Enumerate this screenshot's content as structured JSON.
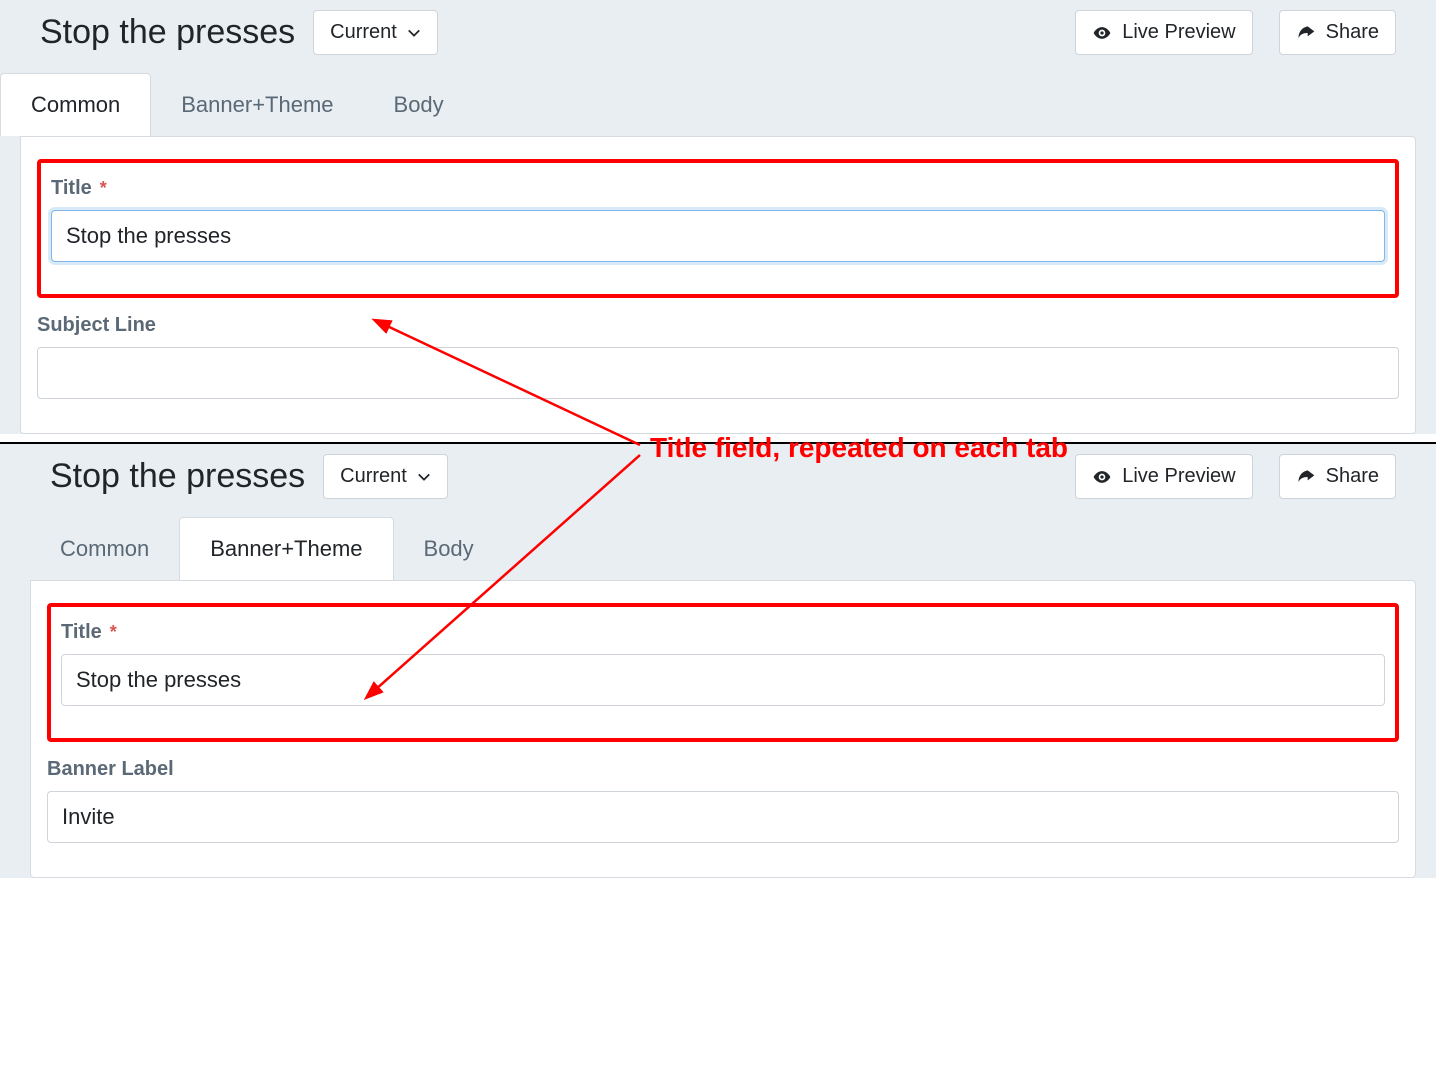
{
  "top": {
    "title": "Stop the presses",
    "dropdown": "Current",
    "preview": "Live Preview",
    "share": "Share",
    "tabs": [
      "Common",
      "Banner+Theme",
      "Body"
    ],
    "active_tab": 0,
    "fields": {
      "title_label": "Title",
      "title_value": "Stop the presses",
      "subject_label": "Subject Line",
      "subject_value": ""
    }
  },
  "bottom": {
    "title": "Stop the presses",
    "dropdown": "Current",
    "preview": "Live Preview",
    "share": "Share",
    "tabs": [
      "Common",
      "Banner+Theme",
      "Body"
    ],
    "active_tab": 1,
    "fields": {
      "title_label": "Title",
      "title_value": "Stop the presses",
      "banner_label": "Banner Label",
      "banner_value": "Invite"
    }
  },
  "annotation": "Title field, repeated on each tab",
  "required_marker": "*"
}
